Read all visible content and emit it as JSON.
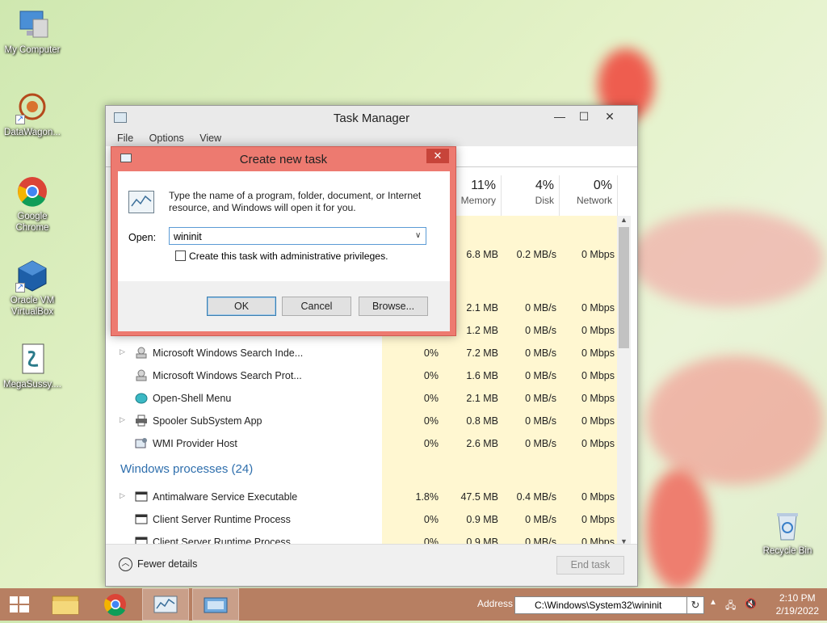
{
  "desktop": {
    "icons": [
      {
        "label": "My Computer",
        "icon": "computer-icon"
      },
      {
        "label": "DataWagon...",
        "icon": "datawagon-icon"
      },
      {
        "label": "Google Chrome",
        "icon": "chrome-icon"
      },
      {
        "label": "Oracle VM VirtualBox",
        "icon": "virtualbox-icon"
      },
      {
        "label": "MegaSussy....",
        "icon": "script-file-icon"
      },
      {
        "label": "Recycle Bin",
        "icon": "recycle-bin-icon"
      }
    ]
  },
  "task_manager": {
    "title": "Task Manager",
    "menu": [
      "File",
      "Options",
      "View"
    ],
    "columns": [
      {
        "pct": "11%",
        "label": "Memory"
      },
      {
        "pct": "4%",
        "label": "Disk"
      },
      {
        "pct": "0%",
        "label": "Network"
      }
    ],
    "partial_rows": [
      {
        "memory": "6.8 MB",
        "disk": "0.2 MB/s",
        "network": "0 Mbps"
      },
      {
        "memory": "2.1 MB",
        "disk": "0 MB/s",
        "network": "0 Mbps"
      },
      {
        "memory": "1.2 MB",
        "disk": "0 MB/s",
        "network": "0 Mbps"
      }
    ],
    "processes": [
      {
        "name": "Microsoft Windows Search Inde...",
        "expand": true,
        "cpu": "0%",
        "memory": "7.2 MB",
        "disk": "0 MB/s",
        "network": "0 Mbps"
      },
      {
        "name": "Microsoft Windows Search Prot...",
        "expand": false,
        "cpu": "0%",
        "memory": "1.6 MB",
        "disk": "0 MB/s",
        "network": "0 Mbps"
      },
      {
        "name": "Open-Shell Menu",
        "expand": false,
        "cpu": "0%",
        "memory": "2.1 MB",
        "disk": "0 MB/s",
        "network": "0 Mbps"
      },
      {
        "name": "Spooler SubSystem App",
        "expand": true,
        "cpu": "0%",
        "memory": "0.8 MB",
        "disk": "0 MB/s",
        "network": "0 Mbps"
      },
      {
        "name": "WMI Provider Host",
        "expand": false,
        "cpu": "0%",
        "memory": "2.6 MB",
        "disk": "0 MB/s",
        "network": "0 Mbps"
      }
    ],
    "group_header": "Windows processes (24)",
    "windows_processes": [
      {
        "name": "Antimalware Service Executable",
        "expand": true,
        "cpu": "1.8%",
        "memory": "47.5 MB",
        "disk": "0.4 MB/s",
        "network": "0 Mbps"
      },
      {
        "name": "Client Server Runtime Process",
        "expand": false,
        "cpu": "0%",
        "memory": "0.9 MB",
        "disk": "0 MB/s",
        "network": "0 Mbps"
      },
      {
        "name": "Client Server Runtime Process",
        "expand": false,
        "cpu": "0%",
        "memory": "0.9 MB",
        "disk": "0 MB/s",
        "network": "0 Mbps"
      }
    ],
    "fewer_details": "Fewer details",
    "end_task": "End task"
  },
  "run_dialog": {
    "title": "Create new task",
    "description": "Type the name of a program, folder, document, or Internet resource, and Windows will open it for you.",
    "open_label": "Open:",
    "open_value": "wininit",
    "admin_checkbox": "Create this task with administrative privileges.",
    "admin_checked": false,
    "ok": "OK",
    "cancel": "Cancel",
    "browse": "Browse..."
  },
  "taskbar": {
    "address_label": "Address",
    "address_value": "C:\\Windows\\System32\\wininit",
    "time": "2:10 PM",
    "date": "2/19/2022"
  },
  "colors": {
    "accent": "#2f6fad",
    "run_frame": "#ed7a70",
    "taskbar": "#b77f62",
    "cpu_highlight": "#fff7d1"
  }
}
